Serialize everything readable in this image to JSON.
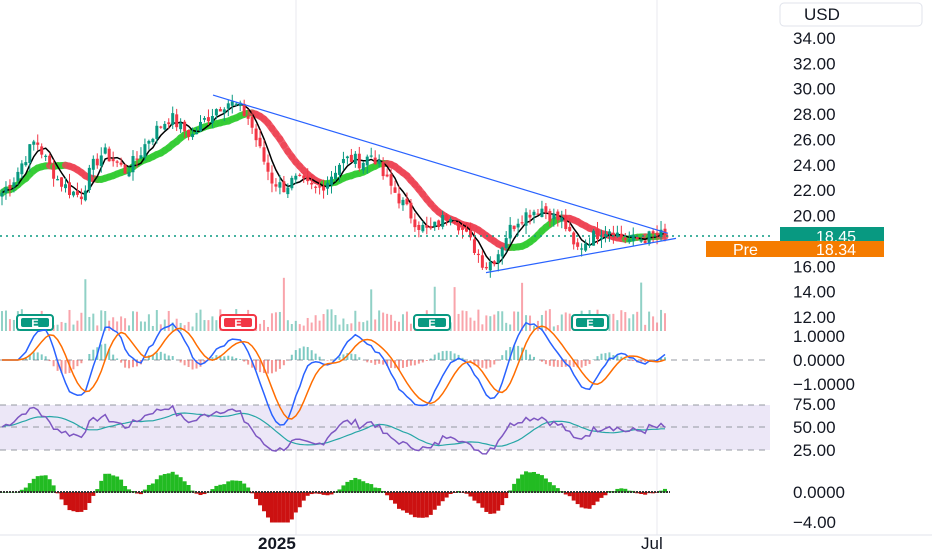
{
  "chart_data": {
    "type": "candlestick",
    "currency": "USD",
    "price_axis": {
      "ticks": [
        "34.00",
        "32.00",
        "30.00",
        "28.00",
        "26.00",
        "24.00",
        "22.00",
        "20.00",
        "16.00",
        "14.00",
        "12.00"
      ],
      "values": [
        34,
        32,
        30,
        28,
        26,
        24,
        22,
        20,
        16,
        14,
        12
      ]
    },
    "last_price": {
      "label": "18.45",
      "value": 18.45,
      "color": "#089981"
    },
    "pre_market": {
      "label": "Pre",
      "price": "18.34",
      "value": 18.34,
      "color": "#f57c00"
    },
    "x_axis": {
      "labels": [
        "2025",
        "Jul"
      ]
    },
    "earnings_markers": [
      {
        "label": "E",
        "beat": true
      },
      {
        "label": "E",
        "beat": false
      },
      {
        "label": "E",
        "beat": true
      },
      {
        "label": "E",
        "beat": true
      }
    ],
    "trendline": {
      "from": 29.5,
      "to": 18.6
    },
    "support_line": {
      "from": 15.5,
      "to": 18.2
    },
    "macd_axis": {
      "ticks": [
        "1.0000",
        "0.0000",
        "−1.0000"
      ],
      "values": [
        1,
        0,
        -1
      ]
    },
    "rsi_axis": {
      "ticks": [
        "75.00",
        "50.00",
        "25.00"
      ],
      "values": [
        75,
        50,
        25
      ],
      "band": [
        70,
        30
      ]
    },
    "osc_axis": {
      "ticks": [
        "0.0000",
        "−4.00"
      ],
      "values": [
        0,
        -4
      ]
    },
    "close_path": [
      21.8,
      22.8,
      24.5,
      26.0,
      24.2,
      22.8,
      22.0,
      21.5,
      23.8,
      25.0,
      24.3,
      23.5,
      24.5,
      26.0,
      27.0,
      27.8,
      26.8,
      26.3,
      27.5,
      28.4,
      29.0,
      28.6,
      27.6,
      25.0,
      22.8,
      22.2,
      22.8,
      22.4,
      22.0,
      22.8,
      24.1,
      24.5,
      24.2,
      24.9,
      23.0,
      21.8,
      20.5,
      19.3,
      18.7,
      19.5,
      20.3,
      18.8,
      17.5,
      16.0,
      16.8,
      18.7,
      19.8,
      20.3,
      20.6,
      19.9,
      19.5,
      17.2,
      18.0,
      18.6,
      19.0,
      18.4,
      18.0,
      18.2,
      18.4,
      18.45
    ],
    "colors": {
      "up": "#089981",
      "down": "#f23645",
      "trendline": "#2962ff",
      "ma_fast": "#000000",
      "ma_up": "#33cc33",
      "ma_down": "#ee4455",
      "macd": "#2962ff",
      "signal": "#ff6d00",
      "rsi": "#7e57c2",
      "rsi_ma": "#26a6a6"
    }
  }
}
